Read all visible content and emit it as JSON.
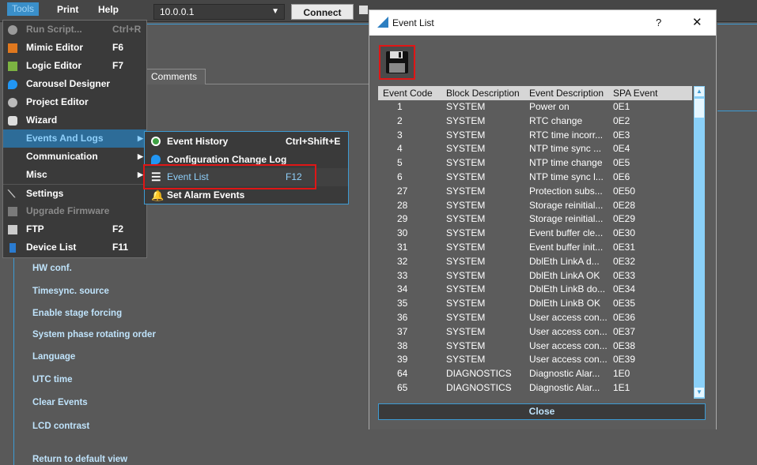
{
  "menubar": {
    "tools": "Tools",
    "print": "Print",
    "help": "Help"
  },
  "connection": {
    "ip": "10.0.0.1",
    "connect": "Connect"
  },
  "tabs": {
    "comments": "Comments"
  },
  "left_list": [
    "HW conf.",
    "Timesync. source",
    "Enable stage forcing",
    "System phase rotating order",
    "Language",
    "UTC time",
    "Clear Events",
    "LCD contrast",
    "Return to default view"
  ],
  "tools_menu": [
    {
      "label": "Run Script...",
      "shortcut": "Ctrl+R",
      "disabled": true,
      "icon": "circle-icon"
    },
    {
      "label": "Mimic Editor",
      "shortcut": "F6",
      "icon": "mimic-icon"
    },
    {
      "label": "Logic Editor",
      "shortcut": "F7",
      "icon": "logic-icon"
    },
    {
      "label": "Carousel Designer",
      "shortcut": "",
      "icon": "drop-icon"
    },
    {
      "label": "Project Editor",
      "shortcut": "",
      "icon": "gear-icon"
    },
    {
      "label": "Wizard",
      "shortcut": "",
      "icon": "wizard-icon"
    },
    {
      "label": "Events And Logs",
      "shortcut": "",
      "submenu": true,
      "highlight": true
    },
    {
      "label": "Communication",
      "shortcut": "",
      "submenu": true
    },
    {
      "label": "Misc",
      "shortcut": "",
      "submenu": true
    },
    {
      "label": "Settings",
      "shortcut": "",
      "icon": "wrench-icon"
    },
    {
      "label": "Upgrade Firmware",
      "shortcut": "",
      "disabled": true,
      "icon": "upgrade-icon"
    },
    {
      "label": "FTP",
      "shortcut": "F2",
      "icon": "ftp-icon"
    },
    {
      "label": "Device List",
      "shortcut": "F11",
      "icon": "device-icon"
    }
  ],
  "events_menu": [
    {
      "label": "Event History",
      "shortcut": "Ctrl+Shift+E"
    },
    {
      "label": "Configuration Change Log",
      "shortcut": ""
    },
    {
      "label": "Event List",
      "shortcut": "F12"
    },
    {
      "label": "Set Alarm Events",
      "shortcut": ""
    }
  ],
  "dialog": {
    "title": "Event List",
    "help": "?",
    "close_x": "✕",
    "close_button": "Close",
    "columns": [
      "Event Code",
      "Block Description",
      "Event Description",
      "SPA Event"
    ],
    "rows": [
      [
        "1",
        "SYSTEM",
        "Power on",
        "0E1"
      ],
      [
        "2",
        "SYSTEM",
        "RTC  change",
        "0E2"
      ],
      [
        "3",
        "SYSTEM",
        "RTC time incorr...",
        "0E3"
      ],
      [
        "4",
        "SYSTEM",
        "NTP time sync ...",
        "0E4"
      ],
      [
        "5",
        "SYSTEM",
        "NTP time change",
        "0E5"
      ],
      [
        "6",
        "SYSTEM",
        "NTP time sync l...",
        "0E6"
      ],
      [
        "27",
        "SYSTEM",
        "Protection subs...",
        "0E50"
      ],
      [
        "28",
        "SYSTEM",
        "Storage reinitial...",
        "0E28"
      ],
      [
        "29",
        "SYSTEM",
        "Storage reinitial...",
        "0E29"
      ],
      [
        "30",
        "SYSTEM",
        "Event buffer cle...",
        "0E30"
      ],
      [
        "31",
        "SYSTEM",
        "Event buffer init...",
        "0E31"
      ],
      [
        "32",
        "SYSTEM",
        "DblEth LinkA d...",
        "0E32"
      ],
      [
        "33",
        "SYSTEM",
        "DblEth LinkA OK",
        "0E33"
      ],
      [
        "34",
        "SYSTEM",
        "DblEth LinkB do...",
        "0E34"
      ],
      [
        "35",
        "SYSTEM",
        "DblEth LinkB OK",
        "0E35"
      ],
      [
        "36",
        "SYSTEM",
        "User access con...",
        "0E36"
      ],
      [
        "37",
        "SYSTEM",
        "User access con...",
        "0E37"
      ],
      [
        "38",
        "SYSTEM",
        "User access con...",
        "0E38"
      ],
      [
        "39",
        "SYSTEM",
        "User access con...",
        "0E39"
      ],
      [
        "64",
        "DIAGNOSTICS",
        "Diagnostic Alar...",
        "1E0"
      ],
      [
        "65",
        "DIAGNOSTICS",
        "Diagnostic Alar...",
        "1E1"
      ]
    ]
  }
}
